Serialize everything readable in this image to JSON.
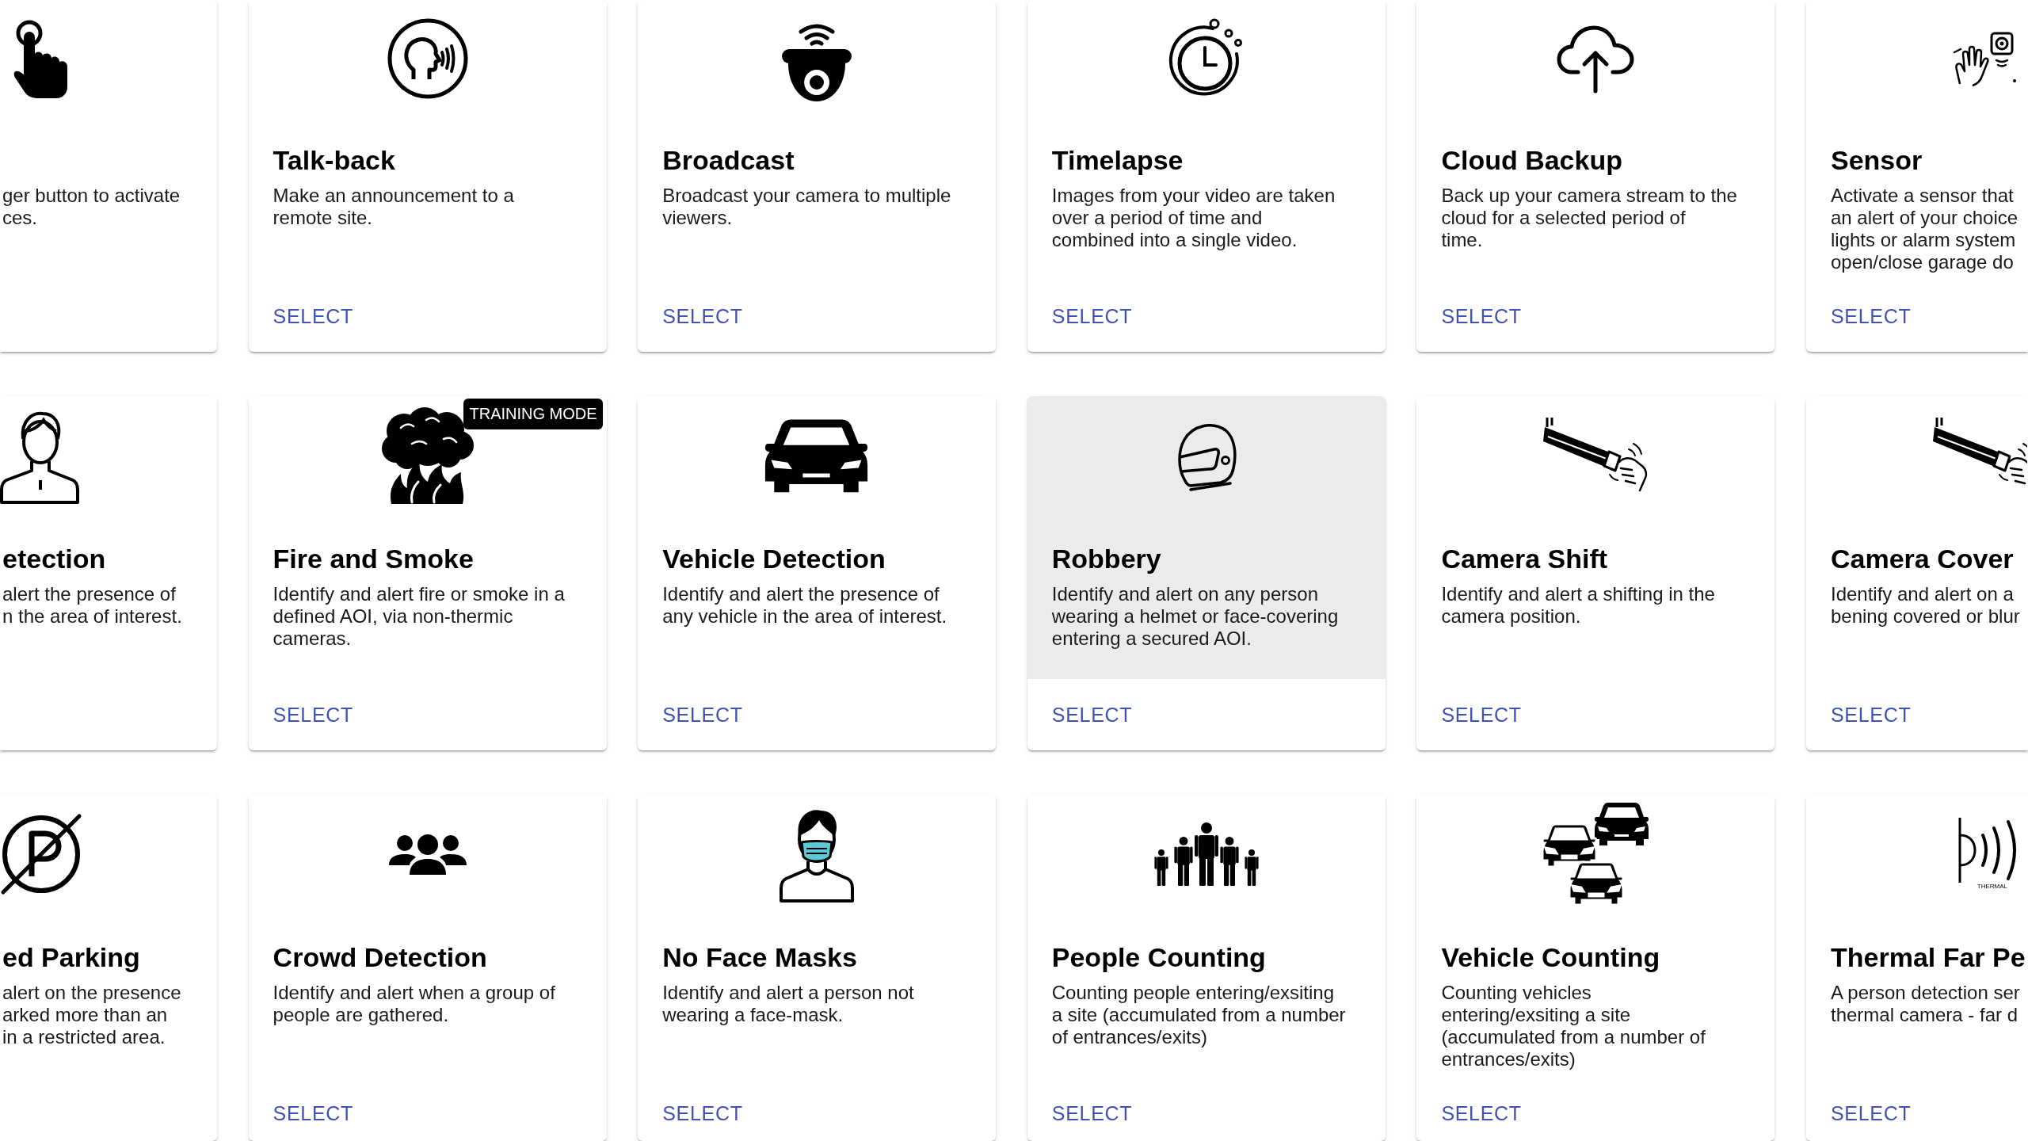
{
  "rows": [
    {
      "cards": [
        {
          "kind": "leftcut",
          "description": "ger button to activate\nces.",
          "hovered": false
        },
        {
          "kind": "full",
          "title": "Talk-back",
          "description": "Make an announcement to a\nremote site.",
          "action": "SELECT",
          "hovered": false
        },
        {
          "kind": "full",
          "title": "Broadcast",
          "description": "Broadcast your camera to multiple\nviewers.",
          "action": "SELECT",
          "hovered": false
        },
        {
          "kind": "full",
          "title": "Timelapse",
          "description": "Images from your video are taken\nover a period of time and\ncombined into a single video.",
          "action": "SELECT",
          "hovered": false
        },
        {
          "kind": "full",
          "title": "Cloud Backup",
          "description": "Back up your camera stream to the\ncloud for a selected period of\ntime.",
          "action": "SELECT",
          "hovered": false
        },
        {
          "kind": "rightcut",
          "title": "Sensor",
          "description": "Activate a sensor that\nan alert of your choice\nlights or alarm system\nopen/close garage do",
          "action": "SELECT",
          "hovered": false
        }
      ]
    },
    {
      "cards": [
        {
          "kind": "leftcut",
          "title": "etection",
          "description": "alert the presence of\nn the area of interest.",
          "hovered": false
        },
        {
          "kind": "full",
          "title": "Fire and Smoke",
          "badge": "TRAINING MODE",
          "description": "Identify and alert fire or smoke in a\ndefined AOI, via non-thermic\ncameras.",
          "action": "SELECT",
          "hovered": false
        },
        {
          "kind": "full",
          "title": "Vehicle Detection",
          "description": "Identify and alert the presence of\nany vehicle in the area of interest.",
          "action": "SELECT",
          "hovered": false
        },
        {
          "kind": "full",
          "title": "Robbery",
          "description": "Identify and alert on any person\nwearing a helmet or face-covering\nentering a secured AOI.",
          "action": "SELECT",
          "hovered": true
        },
        {
          "kind": "full",
          "title": "Camera Shift",
          "description": "Identify and alert a shifting in the\ncamera position.",
          "action": "SELECT",
          "hovered": false
        },
        {
          "kind": "rightcut",
          "title": "Camera Cover",
          "description": "Identify and alert on a\nbening covered or blur",
          "action": "SELECT",
          "hovered": false
        }
      ]
    },
    {
      "cards": [
        {
          "kind": "leftcut",
          "title": "ed Parking",
          "description": "alert on the presence\narked more than an\nin a restricted area.",
          "hovered": false
        },
        {
          "kind": "full",
          "title": "Crowd Detection",
          "description": "Identify and alert when a group of\npeople are gathered.",
          "action": "SELECT",
          "hovered": false
        },
        {
          "kind": "full",
          "title": "No Face Masks",
          "description": "Identify and alert a person not\nwearing a face-mask.",
          "action": "SELECT",
          "hovered": false
        },
        {
          "kind": "full",
          "title": "People Counting",
          "description": "Counting people entering/exsiting\na site (accumulated from a number\nof entrances/exits)",
          "action": "SELECT",
          "hovered": false
        },
        {
          "kind": "full",
          "title": "Vehicle Counting",
          "description": "Counting vehicles\nentering/exsiting a site\n(accumulated from a number of\nentrances/exits)",
          "action": "SELECT",
          "hovered": false
        },
        {
          "kind": "rightcut",
          "title": "Thermal Far Pe",
          "icon_caption": "THERMAL",
          "description": "A person detection ser\nthermal camera - far d",
          "action": "SELECT",
          "hovered": false
        }
      ]
    }
  ]
}
